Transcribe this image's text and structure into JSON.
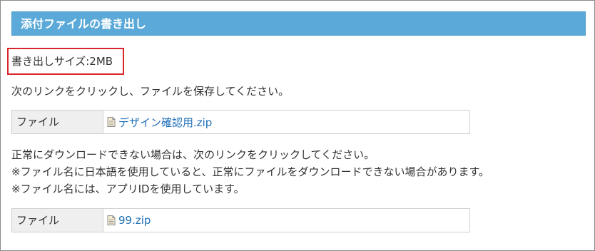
{
  "header": {
    "title": "添付ファイルの書き出し"
  },
  "export": {
    "size_text": "書き出しサイズ:2MB"
  },
  "instructions": {
    "line1": "次のリンクをクリックし、ファイルを保存してください。"
  },
  "file_row_1": {
    "label": "ファイル",
    "link": "デザイン確認用.zip",
    "icon": "document-icon"
  },
  "fallback": {
    "line1": "正常にダウンロードできない場合は、次のリンクをクリックしてください。",
    "line2": "※ファイル名に日本語を使用していると、正常にファイルをダウンロードできない場合があります。",
    "line3": "※ファイル名には、アプリIDを使用しています。"
  },
  "file_row_2": {
    "label": "ファイル",
    "link": "99.zip",
    "icon": "document-icon"
  },
  "colors": {
    "header_bg": "#5aa9d8",
    "highlight_border": "#d9262a",
    "link": "#1e6fb8"
  }
}
